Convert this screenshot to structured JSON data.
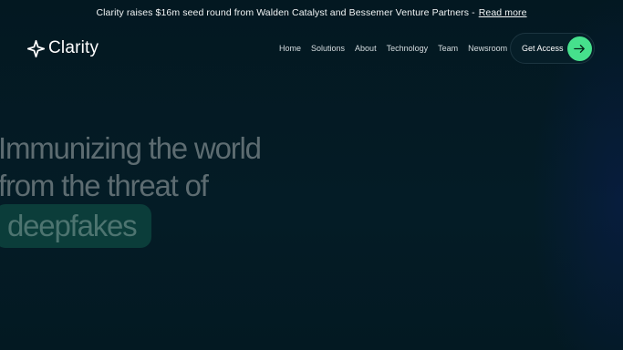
{
  "announcement": {
    "text": "Clarity raises $16m seed round from Walden Catalyst and Bessemer Venture Partners -",
    "link": "Read more"
  },
  "brand": {
    "name": "Clarity",
    "icon": "sparkle-logo-icon"
  },
  "nav": {
    "items": [
      {
        "label": "Home"
      },
      {
        "label": "Solutions"
      },
      {
        "label": "About"
      },
      {
        "label": "Technology"
      },
      {
        "label": "Team"
      },
      {
        "label": "Newsroom"
      }
    ],
    "cta": {
      "label": "Get Access",
      "icon": "arrow-right-icon"
    }
  },
  "hero": {
    "line1": "Immunizing the world",
    "line2": "from the threat of",
    "highlight": "deepfakes"
  },
  "colors": {
    "background": "#031821",
    "accent": "#46e08c",
    "highlight_pill": "#0b3d3a",
    "hero_text": "#5d6c71"
  }
}
